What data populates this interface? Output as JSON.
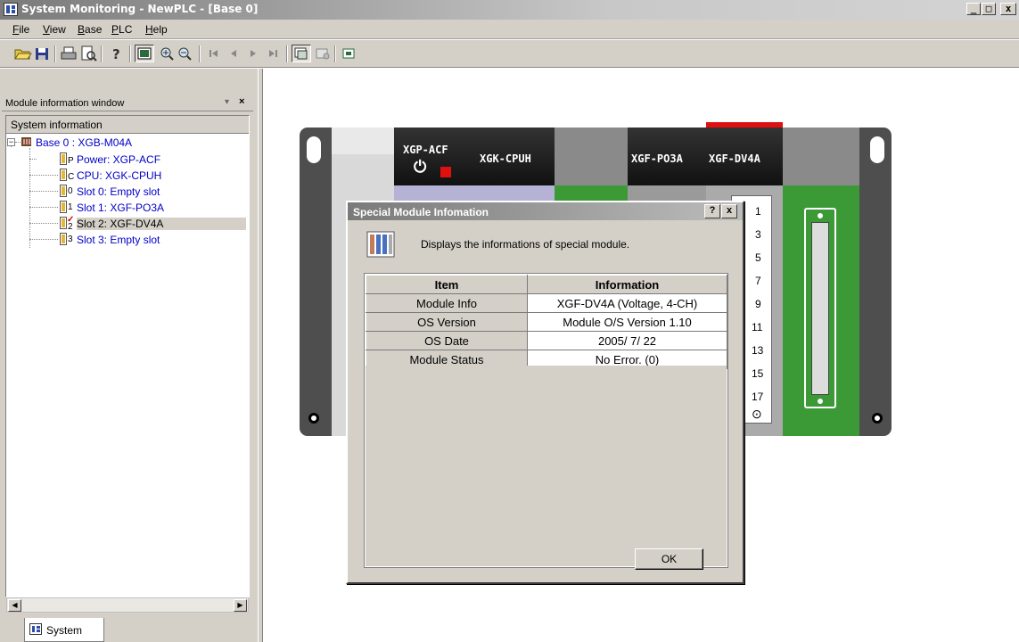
{
  "window": {
    "title": "System Monitoring - NewPLC - [Base 0]",
    "controls": [
      "_",
      "□",
      "x"
    ]
  },
  "menu": [
    "File",
    "View",
    "Base",
    "PLC",
    "Help"
  ],
  "panel": {
    "title": "Module information window",
    "header": "System information",
    "tab": "System"
  },
  "tree": {
    "root": "Base 0 : XGB-M04A",
    "items": [
      {
        "letter": "P",
        "label": "Power: XGP-ACF"
      },
      {
        "letter": "C",
        "label": "CPU: XGK-CPUH"
      },
      {
        "letter": "0",
        "label": "Slot 0: Empty slot"
      },
      {
        "letter": "1",
        "label": "Slot 1: XGF-PO3A"
      },
      {
        "letter": "2",
        "label": "Slot 2: XGF-DV4A",
        "selected": true
      },
      {
        "letter": "3",
        "label": "Slot 3: Empty slot"
      }
    ]
  },
  "base": {
    "modules": [
      "XGP-ACF",
      "XGK-CPUH",
      "XGF-PO3A",
      "XGF-DV4A"
    ],
    "terminal_numbers": [
      "1",
      "3",
      "5",
      "7",
      "9",
      "11",
      "13",
      "15",
      "17"
    ]
  },
  "dialog": {
    "title": "Special Module Infomation",
    "help_button": "?",
    "close_button": "x",
    "description": "Displays the informations of special module.",
    "columns": [
      "Item",
      "Information"
    ],
    "rows": [
      [
        "Module Info",
        "XGF-DV4A (Voltage, 4-CH)"
      ],
      [
        "OS Version",
        "Module O/S Version  1.10"
      ],
      [
        "OS Date",
        "2005/ 7/ 22"
      ],
      [
        "Module Status",
        "No Error. (0)"
      ]
    ],
    "ok_label": "OK"
  }
}
